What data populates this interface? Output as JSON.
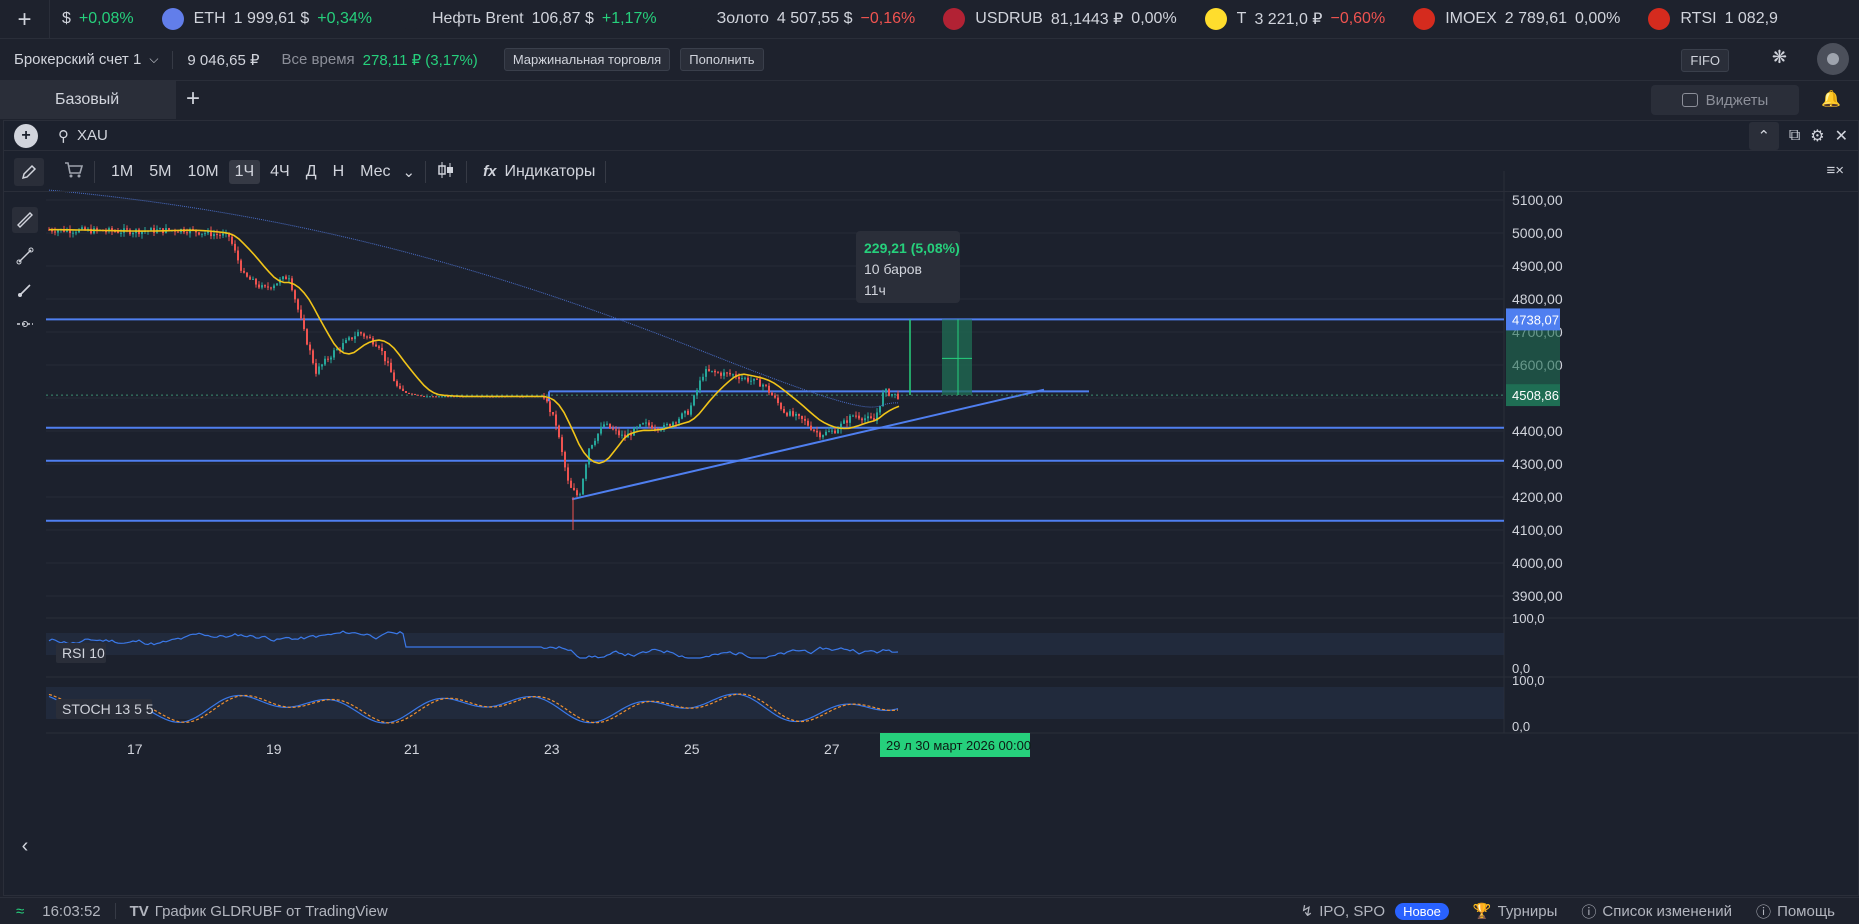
{
  "ticker": {
    "add_icon": "plus-icon",
    "items": [
      {
        "icon": "dollar",
        "name": "$",
        "value": "",
        "change": "+0,08%",
        "dir": "up",
        "color": "#26d07c"
      },
      {
        "icon": "eth-icon",
        "name": "ETH",
        "value": "1 999,61 $",
        "change": "+0,34%",
        "dir": "up",
        "color": "#627eea"
      },
      {
        "icon": "oil-icon",
        "name": "Нефть Brent",
        "value": "106,87 $",
        "change": "+1,17%",
        "dir": "up",
        "color": "#1e222d"
      },
      {
        "icon": "gold-icon",
        "name": "Золото",
        "value": "4 507,55 $",
        "change": "−0,16%",
        "dir": "down",
        "color": "#1e222d"
      },
      {
        "icon": "us-flag-icon",
        "name": "USDRUB",
        "value": "81,1443 ₽",
        "change": "0,00%",
        "dir": "flat",
        "color": "#b22234"
      },
      {
        "icon": "tbank-icon",
        "name": "Т",
        "value": "3 221,0 ₽",
        "change": "−0,60%",
        "dir": "down",
        "color": "#ffdd2d"
      },
      {
        "icon": "ru-flag-icon",
        "name": "IMOEX",
        "value": "2 789,61",
        "change": "0,00%",
        "dir": "flat",
        "color": "#d52b1e"
      },
      {
        "icon": "ru-flag-icon",
        "name": "RTSI",
        "value": "1 082,9",
        "change": "",
        "dir": "flat",
        "color": "#d52b1e"
      }
    ]
  },
  "account": {
    "name": "Брокерский счет 1",
    "balance": "9 046,65 ₽",
    "period_label": "Все время",
    "gain": "278,11 ₽ (3,17%)",
    "margin_btn": "Маржинальная торговля",
    "deposit_btn": "Пополнить",
    "fifo": "FIFO"
  },
  "tabs": {
    "active": "Базовый",
    "widgets": "Виджеты"
  },
  "chart": {
    "symbol": "XAU",
    "timeframes": [
      "1М",
      "5М",
      "10М",
      "1Ч",
      "4Ч",
      "Д",
      "Н",
      "Мес"
    ],
    "active_tf": "1Ч",
    "indicators_label": "Индикаторы",
    "price_labels": [
      "5100,00",
      "5000,00",
      "4900,00",
      "4800,00",
      "4700,00",
      "4600,00",
      "4400,00",
      "4300,00",
      "4200,00",
      "4100,00",
      "4000,00",
      "3900,00"
    ],
    "current_price": "4508,86",
    "level_price": "4738,07",
    "measure": {
      "change": "229,21 (5,08%)",
      "bars": "10 баров",
      "time": "11ч"
    },
    "date_labels": [
      "17",
      "19",
      "21",
      "23",
      "25",
      "27"
    ],
    "crosshair_date": "29 л   30 март 2026 00:00",
    "rsi": {
      "label": "RSI 10",
      "top": "100,0",
      "bottom": "0,0"
    },
    "stoch": {
      "label": "STOCH 13 5 5",
      "top": "100,0",
      "bottom": "0,0"
    }
  },
  "colors": {
    "bull": "#26a69a",
    "bear": "#ef5350",
    "level": "#4f7ff0",
    "ma": "#f0c419",
    "accent_green": "#26d07c"
  },
  "status": {
    "time": "16:03:52",
    "chart_credit": "График GLDRUBF от TradingView",
    "ipo": "IPO, SPO",
    "new_badge": "Новое",
    "tournaments": "Турниры",
    "changelog": "Список изменений",
    "help": "Помощь"
  }
}
